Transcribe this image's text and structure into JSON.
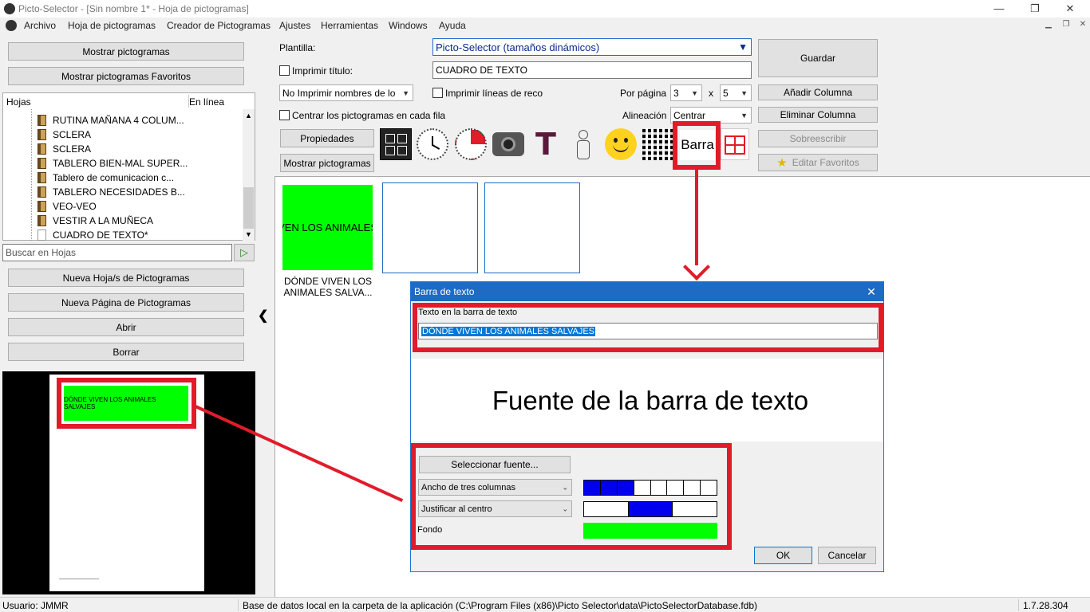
{
  "window": {
    "title": "Picto-Selector - [Sin nombre 1* - Hoja de pictogramas]",
    "minimize": "—",
    "restore": "❐",
    "close": "✕"
  },
  "menu": [
    "Archivo",
    "Hoja de pictogramas",
    "Creador de Pictogramas",
    "Ajustes",
    "Herramientas",
    "Windows",
    "Ayuda"
  ],
  "left": {
    "btn_show": "Mostrar pictogramas",
    "btn_show_fav": "Mostrar pictogramas Favoritos",
    "col_sheets": "Hojas",
    "col_online": "En línea",
    "tree": [
      "RUTINA MAÑANA 4 COLUM...",
      "SCLERA",
      "SCLERA",
      "TABLERO BIEN-MAL SUPER...",
      "Tablero de comunicacion c...",
      "TABLERO NECESIDADES B...",
      "VEO-VEO",
      "VESTIR A LA MUÑECA",
      "CUADRO DE TEXTO*"
    ],
    "search_placeholder": "Buscar en Hojas",
    "btn_new_sheet": "Nueva Hoja/s de Pictogramas",
    "btn_new_page": "Nueva Página de Pictogramas",
    "btn_open": "Abrir",
    "btn_delete": "Borrar",
    "preview_text": "DÓNDE VIVEN LOS ANIMALES SALVAJES",
    "collapse": "❮"
  },
  "toolbar": {
    "template_label": "Plantilla:",
    "template_value": "Picto-Selector (tamaños dinámicos)",
    "print_title_label": "Imprimir título:",
    "title_value": "CUADRO DE TEXTO",
    "names_value": "No Imprimir nombres de lo",
    "print_lines_label": "Imprimir líneas de reco",
    "per_page_label": "Por página",
    "rows_value": "3",
    "x_label": "x",
    "cols_value": "5",
    "center_label": "Centrar los pictogramas en cada fila",
    "align_label": "Alineación",
    "align_value": "Centrar",
    "btn_properties": "Propiedades",
    "btn_show_picto": "Mostrar pictogramas",
    "btn_save": "Guardar",
    "btn_add_col": "Añadir Columna",
    "btn_del_col": "Eliminar Columna",
    "btn_overwrite": "Sobreescribir",
    "btn_edit_fav": "Editar Favoritos",
    "barra_label": "Barra",
    "t_glyph": "T"
  },
  "canvas": {
    "cell1_text": "VEN LOS ANIMALES",
    "cell1_caption": "DÓNDE VIVEN LOS ANIMALES SALVA...",
    "colors": {
      "green": "#00ff00",
      "blue": "#0000ee",
      "red": "#e21b2a"
    }
  },
  "dialog": {
    "title": "Barra de texto",
    "close": "✕",
    "text_label": "Texto en la barra de texto",
    "text_value": "DÓNDE VIVEN LOS ANIMALES SALVAJES",
    "font_preview": "Fuente de la barra de texto",
    "btn_select_font": "Seleccionar fuente...",
    "width_value": "Ancho de tres columnas",
    "justify_value": "Justificar al centro",
    "background_label": "Fondo",
    "btn_ok": "OK",
    "btn_cancel": "Cancelar"
  },
  "status": {
    "user": "Usuario: JMMR",
    "db": "Base de datos local en la carpeta de la aplicación (C:\\Program Files (x86)\\Picto Selector\\data\\PictoSelectorDatabase.fdb)",
    "version": "1.7.28.304"
  }
}
